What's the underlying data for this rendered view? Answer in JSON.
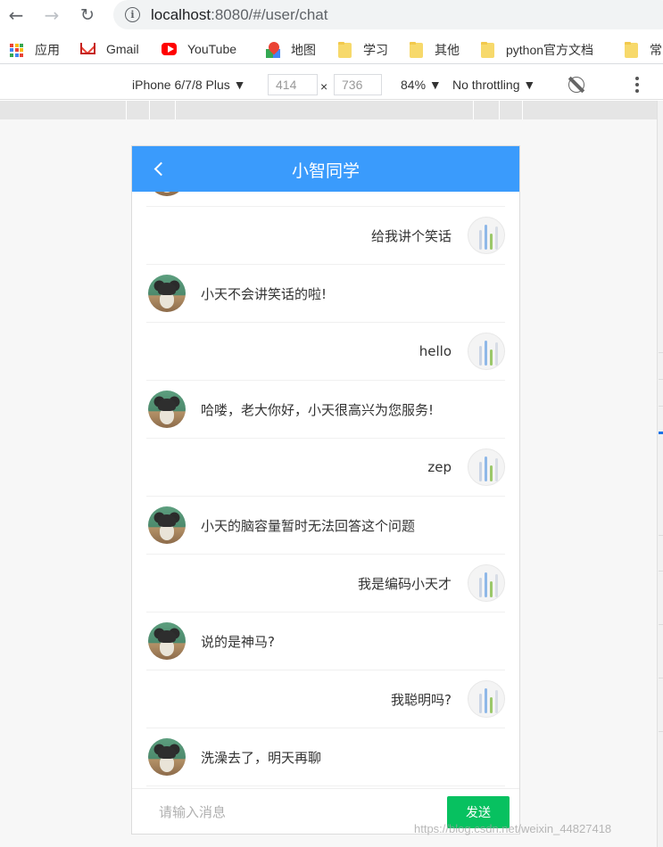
{
  "browser": {
    "url_host": "localhost",
    "url_rest": ":8080/#/user/chat"
  },
  "bookmarks": [
    {
      "label": "应用",
      "icon": "apps-grid-icon"
    },
    {
      "label": "Gmail",
      "icon": "gmail-icon"
    },
    {
      "label": "YouTube",
      "icon": "youtube-icon"
    },
    {
      "label": "地图",
      "icon": "maps-icon"
    },
    {
      "label": "学习",
      "icon": "folder-icon"
    },
    {
      "label": "其他",
      "icon": "folder-icon"
    },
    {
      "label": "python官方文档",
      "icon": "folder-icon"
    },
    {
      "label": "常",
      "icon": "folder-icon"
    }
  ],
  "device_toolbar": {
    "device": "iPhone 6/7/8 Plus",
    "width": "414",
    "height": "736",
    "times": "×",
    "zoom": "84%",
    "throttling": "No throttling"
  },
  "chat": {
    "title": "小智同学",
    "messages": [
      {
        "from": "user",
        "text": "给我讲个笑话"
      },
      {
        "from": "bot",
        "text": "小天不会讲笑话的啦!"
      },
      {
        "from": "user",
        "text": "hello"
      },
      {
        "from": "bot",
        "text": "哈喽，老大你好，小天很高兴为您服务!"
      },
      {
        "from": "user",
        "text": "zep"
      },
      {
        "from": "bot",
        "text": "小天的脑容量暂时无法回答这个问题"
      },
      {
        "from": "user",
        "text": "我是编码小天才"
      },
      {
        "from": "bot",
        "text": "说的是神马?"
      },
      {
        "from": "user",
        "text": "我聪明吗?"
      },
      {
        "from": "bot",
        "text": "洗澡去了，明天再聊"
      }
    ],
    "input_placeholder": "请输入消息",
    "send_label": "发送"
  },
  "watermark": "https://blog.csdn.net/weixin_44827418",
  "colors": {
    "header": "#3a9bfc",
    "send_button": "#07c160"
  }
}
